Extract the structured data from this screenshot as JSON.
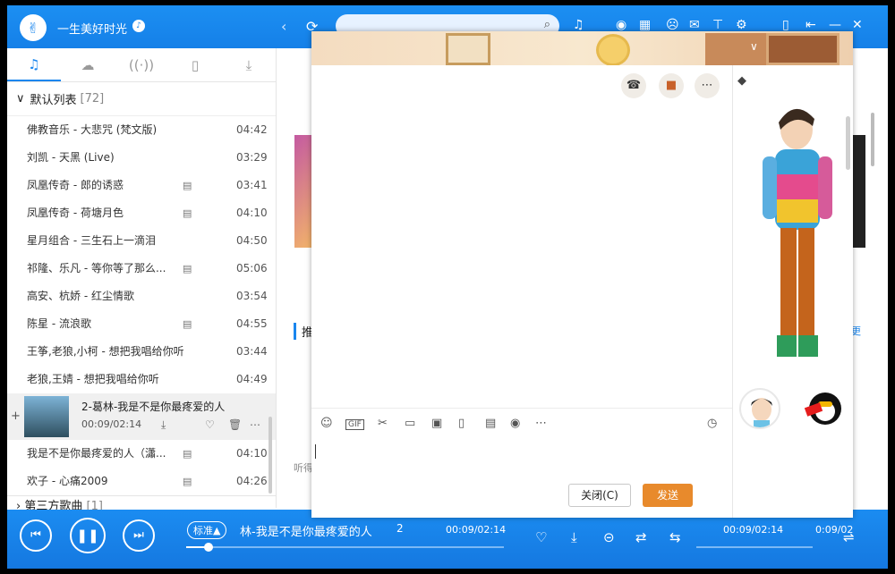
{
  "header": {
    "username": "一生美好时光",
    "search_placeholder": ""
  },
  "left_tabs": [
    "music-note-icon",
    "cloud-icon",
    "radio-icon",
    "device-icon",
    "download-icon"
  ],
  "playlist": {
    "title": "默认列表",
    "count": "[72]",
    "songs": [
      {
        "name": "佛教音乐 - 大悲咒 (梵文版)",
        "mv": false,
        "duration": "04:42"
      },
      {
        "name": "刘凯 - 天黑 (Live)",
        "mv": false,
        "duration": "03:29"
      },
      {
        "name": "凤凰传奇 - 郎的诱惑",
        "mv": true,
        "duration": "03:41"
      },
      {
        "name": "凤凰传奇 - 荷塘月色",
        "mv": true,
        "duration": "04:10"
      },
      {
        "name": "星月组合 - 三生石上一滴泪",
        "mv": false,
        "duration": "04:50"
      },
      {
        "name": "祁隆、乐凡 - 等你等了那么...",
        "mv": true,
        "duration": "05:06"
      },
      {
        "name": "高安、杭娇 - 红尘情歌",
        "mv": false,
        "duration": "03:54"
      },
      {
        "name": "陈星 - 流浪歌",
        "mv": true,
        "duration": "04:55"
      },
      {
        "name": "王筝,老狼,小柯 - 想把我唱给你听",
        "mv": false,
        "duration": "03:44"
      },
      {
        "name": "老狼,王婧 - 想把我唱给你听",
        "mv": false,
        "duration": "04:49"
      }
    ],
    "now_playing": {
      "title": "2-葛林-我是不是你最疼爱的人",
      "time": "00:09/02:14"
    },
    "songs_after": [
      {
        "name": "我是不是你最疼爱的人（瀟...",
        "mv": true,
        "duration": "04:10"
      },
      {
        "name": "欢子 - 心痛2009",
        "mv": true,
        "duration": "04:26"
      }
    ],
    "next_section": "第三方歌曲",
    "next_count": "[1]"
  },
  "content": {
    "section_title": "推",
    "more_link": "更",
    "caption": "听得"
  },
  "player": {
    "quality": "标准▲",
    "now_title": "林-我是不是你最疼爱的人",
    "index": "2",
    "time_left": "00:09/02:14",
    "time_right": "00:09/02:14",
    "time_clip": "0:09/02",
    "progress": 0.07
  },
  "chat": {
    "close_label": "关闭(C)",
    "send_label": "发送",
    "toolbar_icons": [
      "emoji-icon",
      "gif-icon",
      "scissors-icon",
      "folder-icon",
      "image-icon",
      "shake-icon",
      "red-packet-icon",
      "music-icon",
      "more-icon",
      "history-clock-icon"
    ]
  },
  "colors": {
    "brand_blue": "#1a86ee",
    "send_orange": "#e88a2c"
  }
}
